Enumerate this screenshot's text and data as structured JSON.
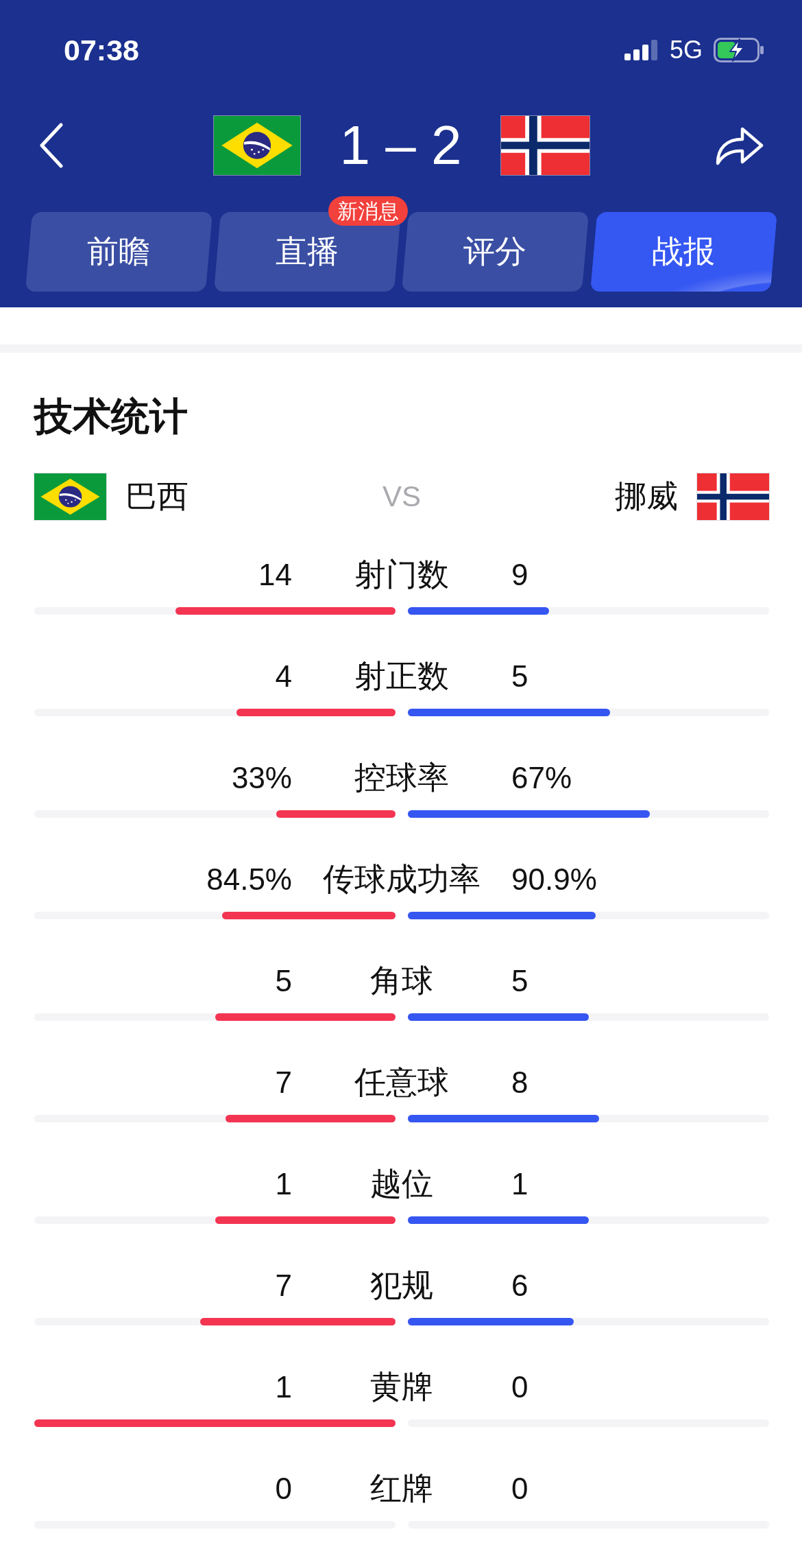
{
  "status_bar": {
    "time": "07:38",
    "network": "5G"
  },
  "header": {
    "score": "1 – 2"
  },
  "tabs": [
    {
      "label": "前瞻",
      "selected": false
    },
    {
      "label": "直播",
      "selected": false,
      "badge": "新消息"
    },
    {
      "label": "评分",
      "selected": false
    },
    {
      "label": "战报",
      "selected": true
    }
  ],
  "stats_section": {
    "title": "技术统计",
    "home_team": "巴西",
    "versus": "VS",
    "away_team": "挪威",
    "rows": [
      {
        "label": "射门数",
        "home": {
          "value": "14",
          "level": 0.61
        },
        "away": {
          "value": "9",
          "level": 0.39
        }
      },
      {
        "label": "射正数",
        "home": {
          "value": "4",
          "level": 0.44
        },
        "away": {
          "value": "5",
          "level": 0.56
        }
      },
      {
        "label": "控球率",
        "home": {
          "value": "33%",
          "level": 0.33
        },
        "away": {
          "value": "67%",
          "level": 0.67
        }
      },
      {
        "label": "传球成功率",
        "home": {
          "value": "84.5%",
          "level": 0.48
        },
        "away": {
          "value": "90.9%",
          "level": 0.52
        }
      },
      {
        "label": "角球",
        "home": {
          "value": "5",
          "level": 0.5
        },
        "away": {
          "value": "5",
          "level": 0.5
        }
      },
      {
        "label": "任意球",
        "home": {
          "value": "7",
          "level": 0.47
        },
        "away": {
          "value": "8",
          "level": 0.53
        }
      },
      {
        "label": "越位",
        "home": {
          "value": "1",
          "level": 0.5
        },
        "away": {
          "value": "1",
          "level": 0.5
        }
      },
      {
        "label": "犯规",
        "home": {
          "value": "7",
          "level": 0.54
        },
        "away": {
          "value": "6",
          "level": 0.46
        }
      },
      {
        "label": "黄牌",
        "home": {
          "value": "1",
          "level": 1
        },
        "away": {
          "value": "0",
          "level": 0
        }
      },
      {
        "label": "红牌",
        "home": {
          "value": "0",
          "level": 0
        },
        "away": {
          "value": "0",
          "level": 0
        }
      }
    ]
  }
}
